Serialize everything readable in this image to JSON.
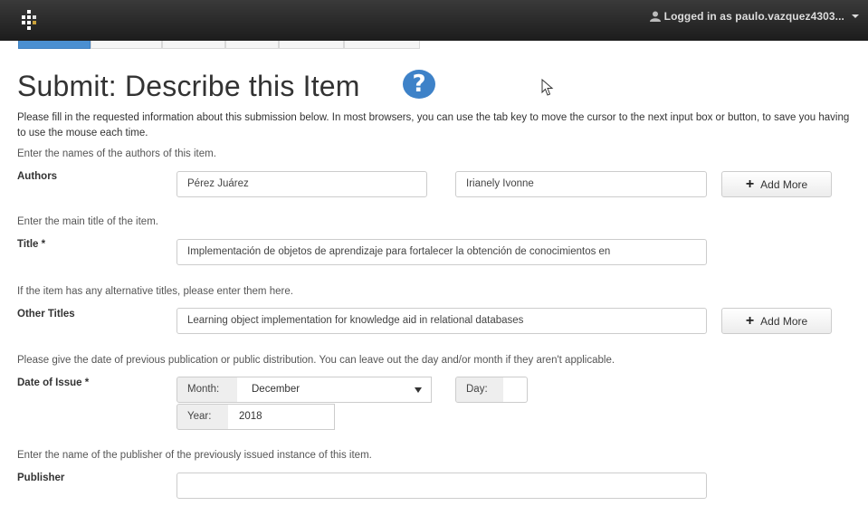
{
  "header": {
    "user_menu_label": "Logged in as paulo.vazquez4303..."
  },
  "page": {
    "title": "Submit: Describe this Item",
    "help_glyph": "?",
    "intro": "Please fill in the requested information about this submission below. In most browsers, you can use the tab key to move the cursor to the next input box or button, to save you having to use the mouse each time."
  },
  "authors": {
    "hint": "Enter the names of the authors of this item.",
    "label": "Authors",
    "last_name": "Pérez Juárez",
    "first_name": "Irianely Ivonne",
    "add_more": "Add More"
  },
  "title_field": {
    "hint": "Enter the main title of the item.",
    "label": "Title *",
    "value": "Implementación de objetos de aprendizaje para fortalecer la obtención de conocimientos en"
  },
  "other_titles": {
    "hint": "If the item has any alternative titles, please enter them here.",
    "label": "Other Titles",
    "value": "Learning object implementation for knowledge aid in relational databases",
    "add_more": "Add More"
  },
  "date_of_issue": {
    "hint": "Please give the date of previous publication or public distribution. You can leave out the day and/or month if they aren't applicable.",
    "label": "Date of Issue *",
    "month_label": "Month:",
    "month_value": "December",
    "day_label": "Day:",
    "day_value": "",
    "year_label": "Year:",
    "year_value": "2018"
  },
  "publisher": {
    "hint": "Enter the name of the publisher of the previously issued instance of this item.",
    "label": "Publisher",
    "value": ""
  },
  "colors": {
    "topbar": "#1c1c1c",
    "accent": "#3e82c8",
    "active_step": "#4a8fd1"
  }
}
